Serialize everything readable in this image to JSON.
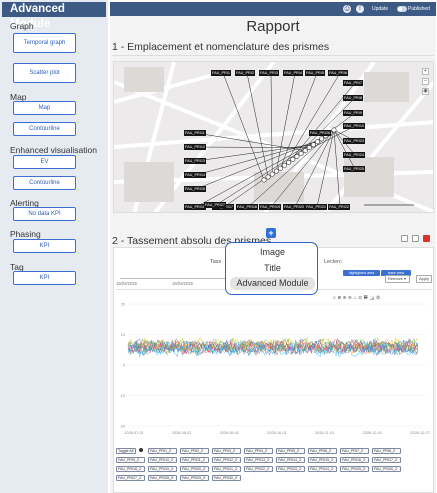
{
  "sidebar": {
    "title": "Advanced Module",
    "sections": [
      {
        "label": "Graph",
        "buttons": [
          "Temporal graph",
          "Scatter plot"
        ]
      },
      {
        "label": "Map",
        "buttons": [
          "Map",
          "Contourline"
        ]
      },
      {
        "label": "Enhanced visualisation",
        "buttons": [
          "EV",
          "Contourline"
        ]
      },
      {
        "label": "Alerting",
        "buttons": [
          "No data KPI"
        ]
      },
      {
        "label": "Phasing",
        "buttons": [
          "KPI"
        ]
      },
      {
        "label": "Tag",
        "buttons": [
          "KPI"
        ]
      }
    ]
  },
  "topbar": {
    "update_label": "Update",
    "published_label": "Published"
  },
  "report": {
    "title": "Rapport",
    "section1_title": "1 - Emplacement et nomenclature des prismes",
    "section2_title": "2 - Tassement absolu des prismes",
    "section2_partial_left": "Tass",
    "section2_partial_right": "Leclerc"
  },
  "map": {
    "prism_labels": [
      "FAU_PRI1",
      "FAU_PRI2",
      "FAU_PRI3",
      "FAU_PRI4",
      "FAU_PRI5",
      "FAU_PRI6",
      "FAU_PRI7",
      "FAU_PRI8",
      "FAU_PRI9",
      "FAU_PRI10",
      "FAU_PRI11",
      "FAU_PRI12",
      "FAU_PRI13",
      "FAU_PRI14",
      "FAU_PRI15",
      "FAU_PRI16",
      "FAU_PRI17",
      "FAU_PRI18",
      "FAU_PRI19",
      "FAU_PRI20",
      "FAU_PRI21",
      "FAU_PRI22",
      "FAU_PRI23",
      "FAU_PRI24",
      "FAU_PRI25",
      "FAU_PRI26",
      "FAU_PRI27"
    ]
  },
  "chart": {
    "date_range_start": "15/03/2026",
    "date_range_mid": "16/03/2026",
    "period_tag1": "highlighted area",
    "period_tag2": "base area",
    "dropdown_label": "Remove",
    "apply_label": "Apply",
    "y_ticks": [
      "20",
      "10",
      "0",
      "-10",
      "-20"
    ],
    "x_ticks": [
      "2026-07-01",
      "2026-08-01",
      "2026-09-01",
      "2026-10-01",
      "2026-11-01",
      "2026-12-01",
      "2026-12-07"
    ]
  },
  "legend": {
    "toggle_label": "Toggle All",
    "items": [
      "FAU_PRI1_Z",
      "FAU_PRI2_Z",
      "FAU_PRI3_Z",
      "FAU_PRI4_Z",
      "FAU_PRI5_Z",
      "FAU_PRI6_Z",
      "FAU_PRI7_Z",
      "FAU_PRI8_Z",
      "FAU_PRI9_Z",
      "FAU_PRI10_Z",
      "FAU_PRI11_Z",
      "FAU_PRI12_Z",
      "FAU_PRI13_Z",
      "FAU_PRI14_Z",
      "FAU_PRI15_Z",
      "FAU_PRI16_Z",
      "FAU_PRI17_Z",
      "FAU_PRI18_Z",
      "FAU_PRI19_Z",
      "FAU_PRI20_Z",
      "FAU_PRI21_Z",
      "FAU_PRI22_Z",
      "FAU_PRI23_Z",
      "FAU_PRI24_Z",
      "FAU_PRI25_Z",
      "FAU_PRI26_Z",
      "FAU_PRI27_Z",
      "FAU_PRI28_Z",
      "FAU_PRI29_Z",
      "FAU_PRI30_Z"
    ]
  },
  "popup": {
    "items": [
      "Image",
      "Title",
      "Advanced Module"
    ]
  },
  "colors": {
    "header": "#3d5a85",
    "accent": "#2f6fd6",
    "sidebar_bg": "#e6ebf2"
  }
}
